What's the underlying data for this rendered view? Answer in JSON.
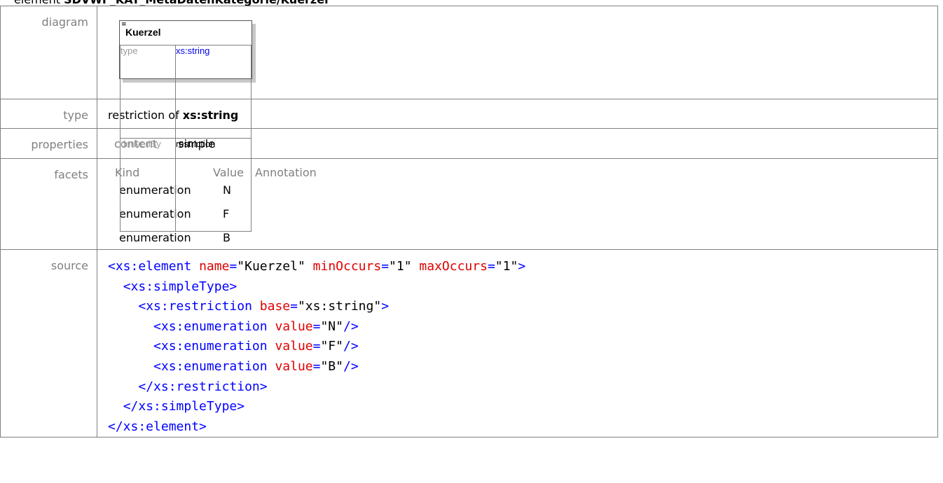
{
  "header": {
    "prefix": "element ",
    "path": "SDVWF_KAT_MetaDatenKategorie/Kuerzel"
  },
  "rows": {
    "diagram_label": "diagram",
    "type_label": "type",
    "properties_label": "properties",
    "facets_label": "facets",
    "source_label": "source"
  },
  "diagram": {
    "name": "Kuerzel",
    "k1": "type",
    "v1": "xs:string",
    "k2": "derivedBy",
    "v2": "restriction"
  },
  "type": {
    "prefix": "restriction of ",
    "base": "xs:string"
  },
  "properties": {
    "key": "content",
    "value": "simple"
  },
  "facets": {
    "headers": [
      "Kind",
      "Value",
      "Annotation"
    ],
    "rows": [
      {
        "kind": "enumeration",
        "value": "N"
      },
      {
        "kind": "enumeration",
        "value": "F"
      },
      {
        "kind": "enumeration",
        "value": "B"
      }
    ]
  },
  "source": {
    "l1_tag": "<xs:element",
    "l1_a1": "name",
    "l1_v1": "\"Kuerzel\"",
    "l1_a2": "minOccurs",
    "l1_v2": "\"1\"",
    "l1_a3": "maxOccurs",
    "l1_v3": "\"1\"",
    "l1_end": ">",
    "l2": "<xs:simpleType>",
    "l3_tag": "<xs:restriction",
    "l3_a": "base",
    "l3_v": "\"xs:string\"",
    "l3_end": ">",
    "l4_tag": "<xs:enumeration",
    "l4_a": "value",
    "l4_v": "\"N\"",
    "l4_end": "/>",
    "l5_tag": "<xs:enumeration",
    "l5_a": "value",
    "l5_v": "\"F\"",
    "l5_end": "/>",
    "l6_tag": "<xs:enumeration",
    "l6_a": "value",
    "l6_v": "\"B\"",
    "l6_end": "/>",
    "l7": "</xs:restriction>",
    "l8": "</xs:simpleType>",
    "l9": "</xs:element>"
  }
}
